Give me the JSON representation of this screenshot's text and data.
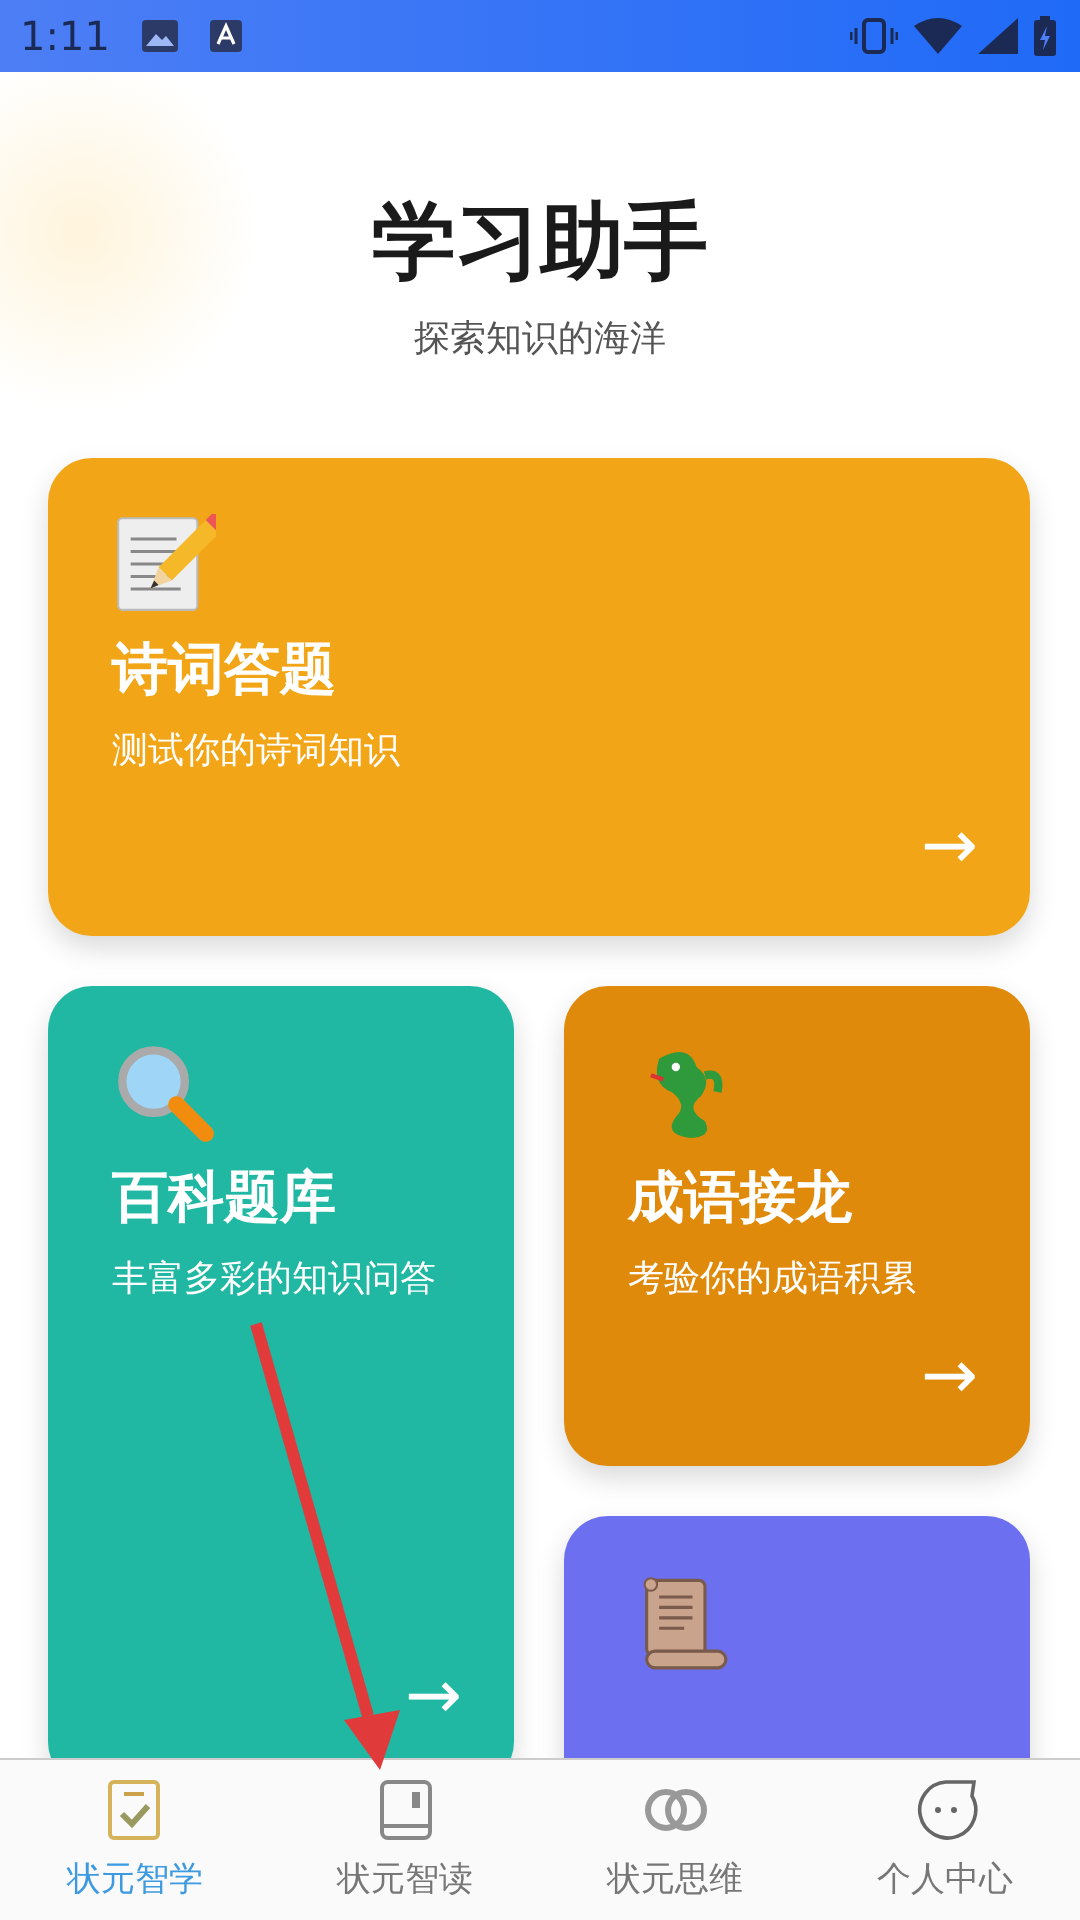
{
  "status_bar": {
    "time": "1:11"
  },
  "header": {
    "title": "学习助手",
    "subtitle": "探索知识的海洋"
  },
  "cards": [
    {
      "title": "诗词答题",
      "description": "测试你的诗词知识",
      "arrow": "→",
      "color": "#f2a516"
    },
    {
      "title": "百科题库",
      "description": "丰富多彩的知识问答",
      "arrow": "→",
      "color": "#21b8a3"
    },
    {
      "title": "成语接龙",
      "description": "考验你的成语积累",
      "arrow": "→",
      "color": "#e08a0c"
    },
    {
      "color": "#6c70f0"
    }
  ],
  "tabs": [
    {
      "label": "状元智学",
      "selected": true
    },
    {
      "label": "状元智读",
      "selected": false
    },
    {
      "label": "状元思维",
      "selected": false
    },
    {
      "label": "个人中心",
      "selected": false
    }
  ]
}
